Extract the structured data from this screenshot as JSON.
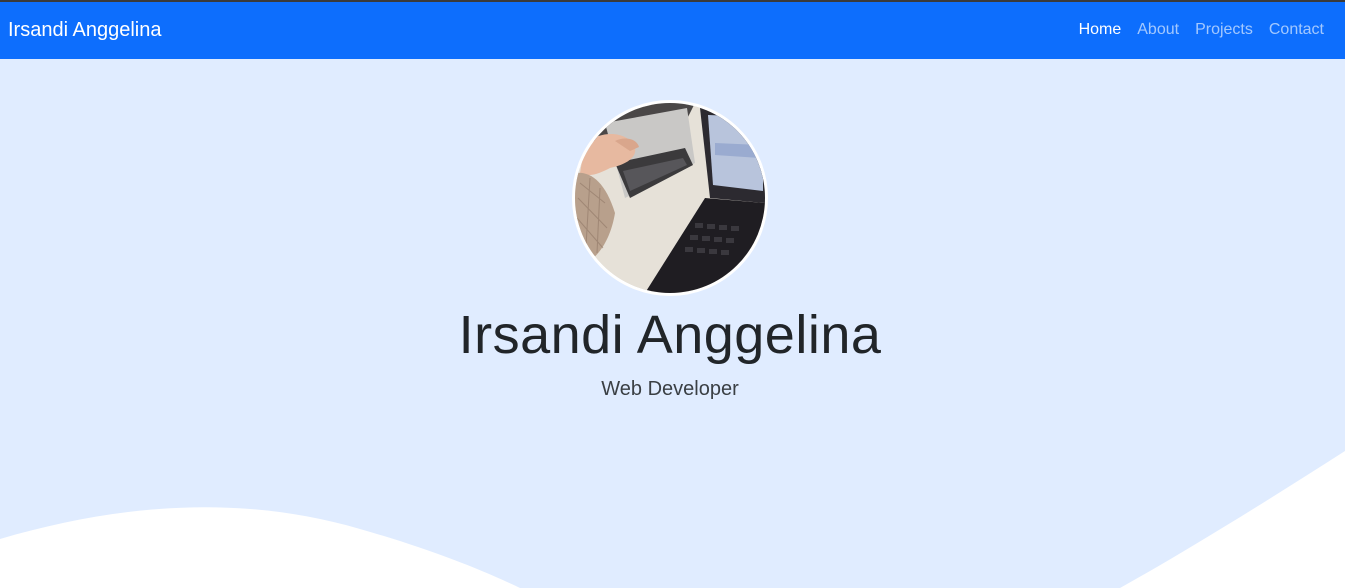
{
  "navbar": {
    "brand": "Irsandi Anggelina",
    "links": [
      {
        "label": "Home",
        "active": true
      },
      {
        "label": "About",
        "active": false
      },
      {
        "label": "Projects",
        "active": false
      },
      {
        "label": "Contact",
        "active": false
      }
    ]
  },
  "hero": {
    "name": "Irsandi Anggelina",
    "role": "Web Developer",
    "avatar_description_icon": "profile-photo"
  },
  "colors": {
    "navbar": "#0d6efd",
    "hero_background": "#e0ecff",
    "wave": "#ffffff",
    "text": "#212529"
  }
}
